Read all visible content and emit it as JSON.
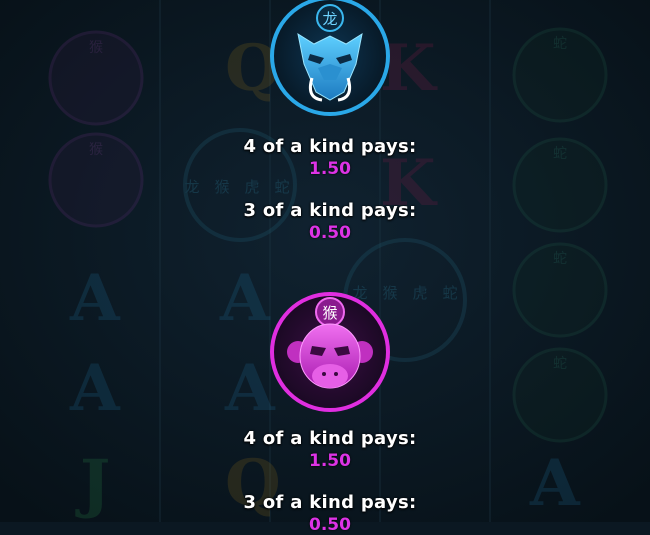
{
  "paytable": {
    "symbols": [
      {
        "name": "Dragon",
        "badge_glyph": "龙",
        "accent": "#2aa8e8",
        "pays": [
          {
            "label": "4 of a kind pays:",
            "value": "1.50"
          },
          {
            "label": "3 of a kind pays:",
            "value": "0.50"
          }
        ]
      },
      {
        "name": "Monkey",
        "badge_glyph": "猴",
        "accent": "#e02ee0",
        "pays": [
          {
            "label": "4 of a kind pays:",
            "value": "1.50"
          },
          {
            "label": "3 of a kind pays:",
            "value": "0.50"
          }
        ]
      }
    ]
  },
  "background": {
    "reel_glyphs": [
      "A",
      "J",
      "Q",
      "K"
    ],
    "medallion_glyphs": [
      "龙",
      "猴",
      "虎",
      "蛇"
    ],
    "snake_glyph": "蛇",
    "monkey_glyph": "猴"
  },
  "colors": {
    "background": "#0b1822",
    "pay_value": "#dd33e6",
    "label": "#ffffff",
    "dragon_accent": "#2aa8e8",
    "monkey_accent": "#e02ee0"
  }
}
